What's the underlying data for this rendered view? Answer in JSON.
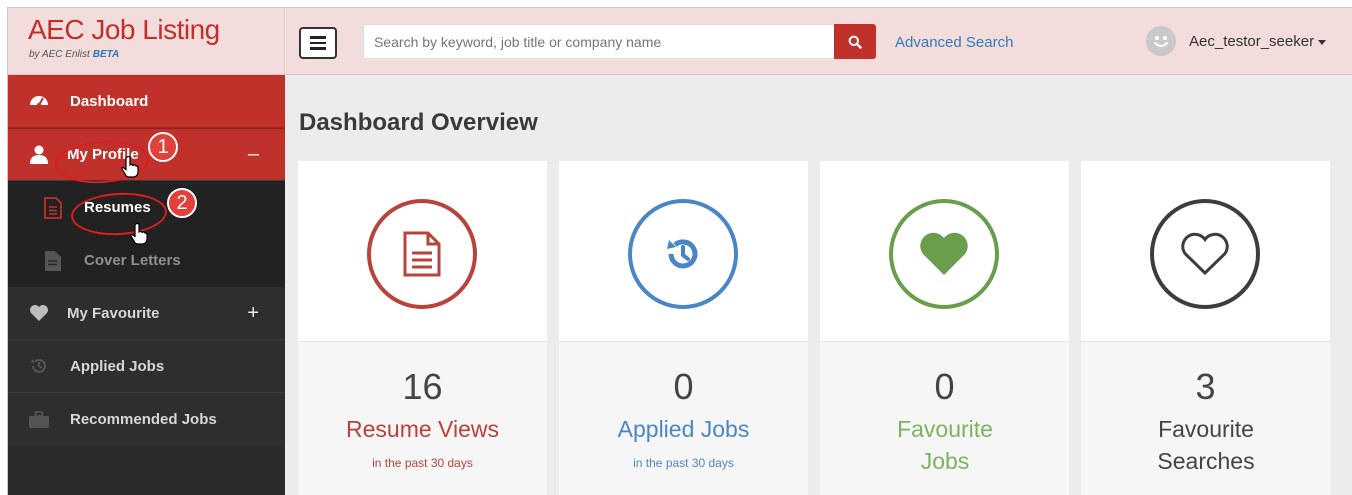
{
  "brand": {
    "title_part1": "AEC",
    "title_part2": "Job Listing",
    "subtitle": "by AEC Enlist",
    "beta": "BETA"
  },
  "search": {
    "placeholder": "Search by keyword, job title or company name",
    "advanced": "Advanced Search"
  },
  "user": {
    "name": "Aec_testor_seeker"
  },
  "sidebar": {
    "items": [
      {
        "label": "Dashboard",
        "icon": "dashboard-icon"
      },
      {
        "label": "My Profile",
        "icon": "user-icon",
        "toggle": "–"
      },
      {
        "label": "Resumes",
        "icon": "document-icon"
      },
      {
        "label": "Cover Letters",
        "icon": "file-icon"
      },
      {
        "label": "My Favourite",
        "icon": "heart-icon",
        "toggle": "+"
      },
      {
        "label": "Applied Jobs",
        "icon": "history-icon"
      },
      {
        "label": "Recommended Jobs",
        "icon": "briefcase-icon"
      }
    ]
  },
  "annotations": {
    "step1": "1",
    "step2": "2"
  },
  "main": {
    "title": "Dashboard Overview",
    "cards": [
      {
        "count": "16",
        "label": "Resume Views",
        "sub": "in the past 30 days",
        "color": "#b8423c",
        "icon": "document-icon"
      },
      {
        "count": "0",
        "label": "Applied Jobs",
        "sub": "in the past 30 days",
        "color": "#4a86c5",
        "icon": "history-icon"
      },
      {
        "count": "0",
        "label": "Favourite Jobs",
        "sub": "",
        "color": "#6a9e4c",
        "icon": "heart-filled-icon"
      },
      {
        "count": "3",
        "label": "Favourite Searches",
        "sub": "",
        "color": "#3d3d3d",
        "icon": "heart-outline-icon"
      }
    ]
  }
}
